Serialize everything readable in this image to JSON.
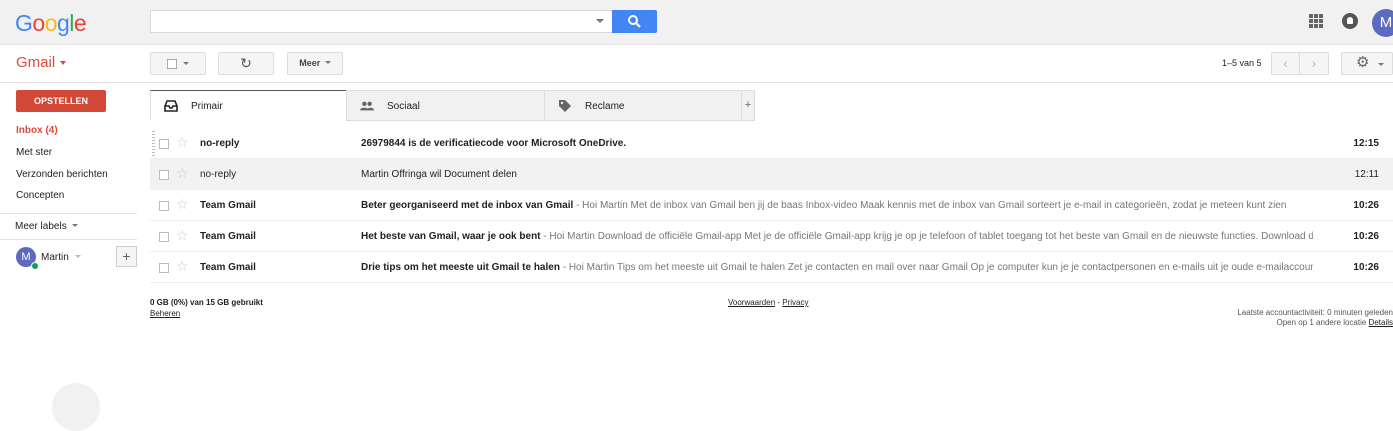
{
  "header": {
    "logo_letters": [
      {
        "ch": "G",
        "color": "#4285f4"
      },
      {
        "ch": "o",
        "color": "#ea4335"
      },
      {
        "ch": "o",
        "color": "#fbbc05"
      },
      {
        "ch": "g",
        "color": "#4285f4"
      },
      {
        "ch": "l",
        "color": "#34a853"
      },
      {
        "ch": "e",
        "color": "#ea4335"
      }
    ],
    "search_value": "",
    "avatar_letter": "M"
  },
  "toolbar": {
    "app_label": "Gmail",
    "more_label": "Meer",
    "refresh_icon": "↻",
    "pager_text": "1–5 van 5",
    "prev_icon": "‹",
    "next_icon": "›",
    "settings_icon": "⚙"
  },
  "sidebar": {
    "compose_label": "OPSTELLEN",
    "items": [
      {
        "label": "Inbox (4)",
        "active": true
      },
      {
        "label": "Met ster",
        "active": false
      },
      {
        "label": "Verzonden berichten",
        "active": false
      },
      {
        "label": "Concepten",
        "active": false
      }
    ],
    "more_labels": "Meer labels",
    "chat_user": "Martin",
    "chat_avatar_letter": "M",
    "add_icon": "+"
  },
  "tabs": [
    {
      "label": "Primair",
      "icon": "inbox-icon",
      "active": true
    },
    {
      "label": "Sociaal",
      "icon": "people-icon",
      "active": false
    },
    {
      "label": "Reclame",
      "icon": "tag-icon",
      "active": false
    }
  ],
  "tab_add": "+",
  "emails": [
    {
      "from": "no-reply",
      "subject": "26979844 is de verificatiecode voor Microsoft OneDrive.",
      "snippet": "",
      "time": "12:15",
      "unread": true
    },
    {
      "from": "no-reply",
      "subject": "Martin Offringa wil Document delen",
      "snippet": "",
      "time": "12:11",
      "unread": false
    },
    {
      "from": "Team Gmail",
      "subject": "Beter georganiseerd met de inbox van Gmail",
      "snippet": " - Hoi Martin Met de inbox van Gmail ben jij de baas Inbox-video Maak kennis met de inbox van Gmail sorteert je e-mail in categorieën, zodat je meteen kunt zien",
      "time": "10:26",
      "unread": true
    },
    {
      "from": "Team Gmail",
      "subject": "Het beste van Gmail, waar je ook bent",
      "snippet": " - Hoi Martin Download de officiële Gmail-app Met je de officiële Gmail-app krijg je op je telefoon of tablet toegang tot het beste van Gmail en de nieuwste functies. Download de",
      "time": "10:26",
      "unread": true
    },
    {
      "from": "Team Gmail",
      "subject": "Drie tips om het meeste uit Gmail te halen",
      "snippet": " - Hoi Martin Tips om het meeste uit Gmail te halen Zet je contacten en mail over naar Gmail Op je computer kun je je contactpersonen en e-mails uit je oude e-mailaccount",
      "time": "10:26",
      "unread": true
    }
  ],
  "footer": {
    "storage": "0 GB (0%) van 15 GB gebruikt",
    "manage": "Beheren",
    "terms": "Voorwaarden",
    "sep": " - ",
    "privacy": "Privacy",
    "activity_line1": "Laatste accountactiviteit: 0 minuten geleden",
    "activity_line2": "Open op 1 andere locatie",
    "details": "Details"
  }
}
